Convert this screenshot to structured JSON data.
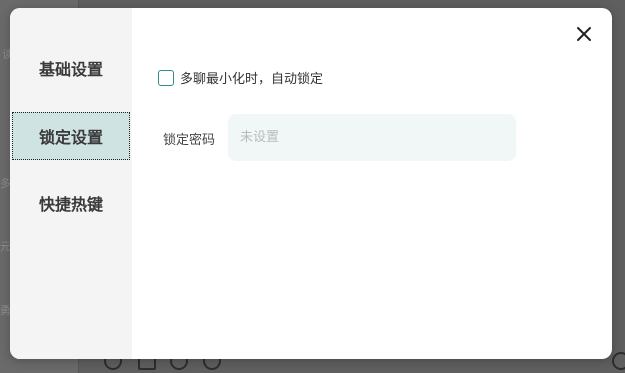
{
  "dialog": {
    "close_icon": "close-icon",
    "sidebar": {
      "items": [
        {
          "label": "基础设置",
          "active": false
        },
        {
          "label": "锁定设置",
          "active": true
        },
        {
          "label": "快捷热键",
          "active": false
        }
      ]
    },
    "lock_settings": {
      "auto_lock_checkbox": {
        "label": "多聊最小化时，自动锁定",
        "checked": false
      },
      "password": {
        "label": "锁定密码",
        "placeholder": "未设置",
        "value": ""
      }
    }
  },
  "colors": {
    "accent": "#2f8f8a",
    "active_nav_bg": "#cfe3e3",
    "sidebar_bg": "#f4f4f4",
    "input_bg": "#f1f7f7",
    "overlay_bg": "#5f5f5f"
  }
}
